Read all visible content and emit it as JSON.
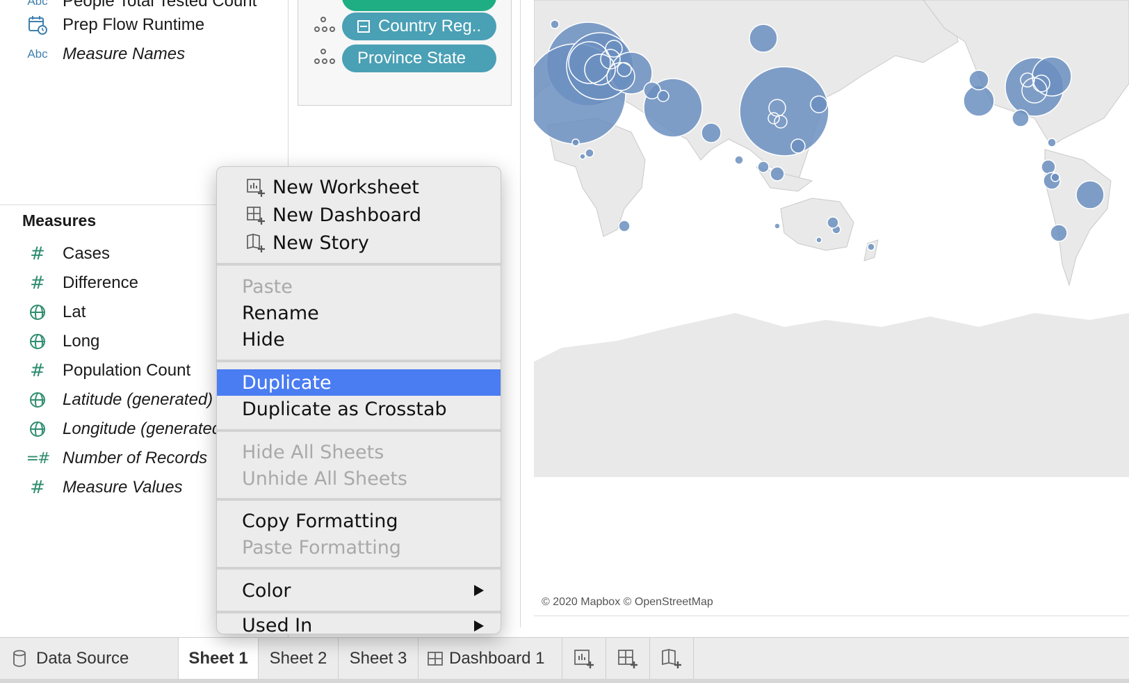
{
  "data_pane": {
    "dimensions": [
      {
        "label": "People Total Tested Count",
        "icon": "abc-icon",
        "italic": false
      },
      {
        "label": "Prep Flow Runtime",
        "icon": "calendar-time-icon",
        "italic": false
      },
      {
        "label": "Measure Names",
        "icon": "abc-icon",
        "italic": true
      }
    ],
    "measures_title": "Measures",
    "measures": [
      {
        "label": "Cases",
        "icon": "hash-icon",
        "italic": false
      },
      {
        "label": "Difference",
        "icon": "hash-icon",
        "italic": false
      },
      {
        "label": "Lat",
        "icon": "globe-icon",
        "italic": false
      },
      {
        "label": "Long",
        "icon": "globe-icon",
        "italic": false
      },
      {
        "label": "Population Count",
        "icon": "hash-icon",
        "italic": false
      },
      {
        "label": "Latitude (generated)",
        "icon": "globe-icon",
        "italic": true
      },
      {
        "label": "Longitude (generated)",
        "icon": "globe-icon",
        "italic": true
      },
      {
        "label": "Number of Records",
        "icon": "calc-hash-icon",
        "italic": true
      },
      {
        "label": "Measure Values",
        "icon": "hash-icon",
        "italic": true
      }
    ],
    "abc_text": "Abc"
  },
  "marks": {
    "pills": [
      {
        "label": "Country Reg..",
        "color": "#4aa0b5",
        "collapse": true
      },
      {
        "label": "Province State",
        "color": "#4aa0b5",
        "collapse": false
      }
    ]
  },
  "map": {
    "attribution": "© 2020 Mapbox © OpenStreetMap",
    "mark_color": "#6b8fc0",
    "land_color": "#e9e9e9"
  },
  "context_menu": {
    "sections": [
      [
        {
          "label": "New Worksheet",
          "icon": "new-worksheet-icon",
          "disabled": false
        },
        {
          "label": "New Dashboard",
          "icon": "new-dashboard-icon",
          "disabled": false
        },
        {
          "label": "New Story",
          "icon": "new-story-icon",
          "disabled": false
        }
      ],
      [
        {
          "label": "Paste",
          "disabled": true
        },
        {
          "label": "Rename",
          "disabled": false
        },
        {
          "label": "Hide",
          "disabled": false
        }
      ],
      [
        {
          "label": "Duplicate",
          "disabled": false,
          "highlighted": true
        },
        {
          "label": "Duplicate as Crosstab",
          "disabled": false
        }
      ],
      [
        {
          "label": "Hide All Sheets",
          "disabled": true
        },
        {
          "label": "Unhide All Sheets",
          "disabled": true
        }
      ],
      [
        {
          "label": "Copy Formatting",
          "disabled": false
        },
        {
          "label": "Paste Formatting",
          "disabled": true
        }
      ],
      [
        {
          "label": "Color",
          "disabled": false,
          "submenu": true
        }
      ],
      [
        {
          "label": "Used In",
          "disabled": false,
          "submenu": true
        }
      ]
    ],
    "highlight_color": "#4a7cf2"
  },
  "tabs": {
    "data_source": "Data Source",
    "sheets": [
      "Sheet 1",
      "Sheet 2",
      "Sheet 3"
    ],
    "dashboard": "Dashboard 1",
    "active": "Sheet 1"
  }
}
